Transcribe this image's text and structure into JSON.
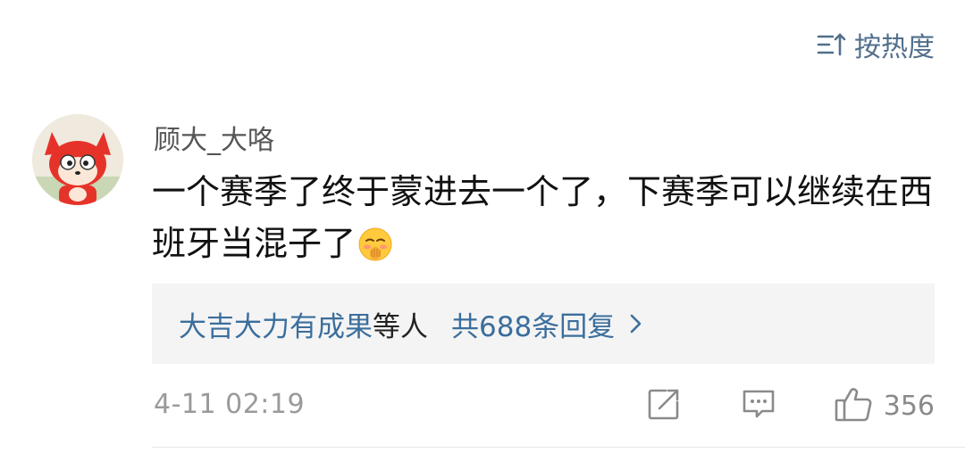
{
  "sort": {
    "label": "按热度",
    "icon": "sort-icon"
  },
  "comment": {
    "username": "顾大_大咯",
    "text": "一个赛季了终于蒙进去一个了，下赛季可以继续在西班牙当混子了",
    "emoji": "shy-face-emoji",
    "avatar": "fox-avatar"
  },
  "replies": {
    "names": "大吉大力有成果",
    "suffix": "等人",
    "count_label": "共688条回复"
  },
  "meta": {
    "timestamp": "4-11 02:19",
    "like_count": "356"
  },
  "colors": {
    "link": "#3b6e9c",
    "sort": "#526f8c",
    "avatar_red": "#e6332a"
  }
}
